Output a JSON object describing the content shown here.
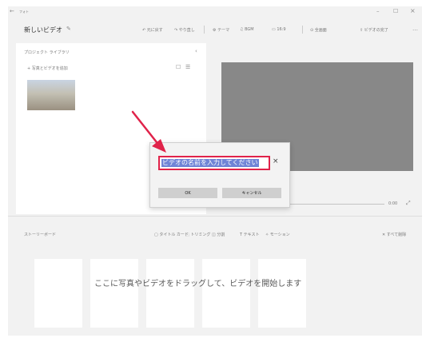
{
  "titlebar": {
    "back": "←",
    "app_name": "フォト",
    "minimize": "–",
    "maximize": "☐",
    "close": "×"
  },
  "header": {
    "title": "新しいビデオ",
    "undo": "元に戻す",
    "redo": "やり直し",
    "theme": "テーマ",
    "music": "BGM",
    "aspect": "16:9",
    "fullscreen": "全画面",
    "finish": "ビデオの完了",
    "more": "…"
  },
  "library": {
    "title": "プロジェクト ライブラリ",
    "add_label": "+ 写真とビデオを追加",
    "collapse": "‹"
  },
  "dialog": {
    "input_value": "ビデオの名前を入力してください",
    "clear": "×",
    "ok_label": "OK",
    "cancel_label": "キャンセル"
  },
  "player": {
    "time": "0:00",
    "expand": "⤢"
  },
  "storyboard": {
    "title": "ストーリーボード",
    "tools": [
      "タイトル カード",
      "トリミング",
      "分割",
      "テキスト",
      "モーション"
    ],
    "remove_all": "すべて削除",
    "hint": "ここに写真やビデオをドラッグして、ビデオを開始します"
  },
  "colors": {
    "accent": "#e0234a",
    "selection": "#6f84d6"
  }
}
